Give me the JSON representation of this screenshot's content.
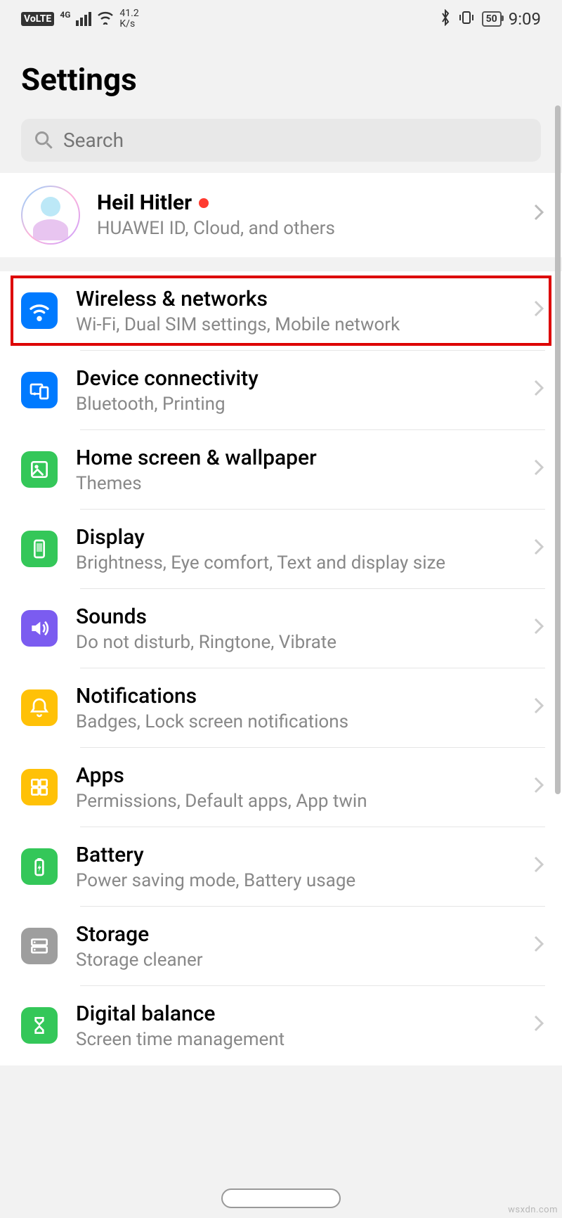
{
  "status": {
    "volte": "VoLTE",
    "net_label": "4G",
    "speed_top": "41.2",
    "speed_bot": "K/s",
    "battery": "50",
    "time": "9:09"
  },
  "title": "Settings",
  "search": {
    "placeholder": "Search"
  },
  "account": {
    "name": "Heil Hitler",
    "subtitle": "HUAWEI ID, Cloud, and others"
  },
  "items": [
    {
      "title": "Wireless & networks",
      "subtitle": "Wi-Fi, Dual SIM settings, Mobile network"
    },
    {
      "title": "Device connectivity",
      "subtitle": "Bluetooth, Printing"
    },
    {
      "title": "Home screen & wallpaper",
      "subtitle": "Themes"
    },
    {
      "title": "Display",
      "subtitle": "Brightness, Eye comfort, Text and display size"
    },
    {
      "title": "Sounds",
      "subtitle": "Do not disturb, Ringtone, Vibrate"
    },
    {
      "title": "Notifications",
      "subtitle": "Badges, Lock screen notifications"
    },
    {
      "title": "Apps",
      "subtitle": "Permissions, Default apps, App twin"
    },
    {
      "title": "Battery",
      "subtitle": "Power saving mode, Battery usage"
    },
    {
      "title": "Storage",
      "subtitle": "Storage cleaner"
    },
    {
      "title": "Digital balance",
      "subtitle": "Screen time management"
    }
  ],
  "watermark": "wsxdn.com"
}
